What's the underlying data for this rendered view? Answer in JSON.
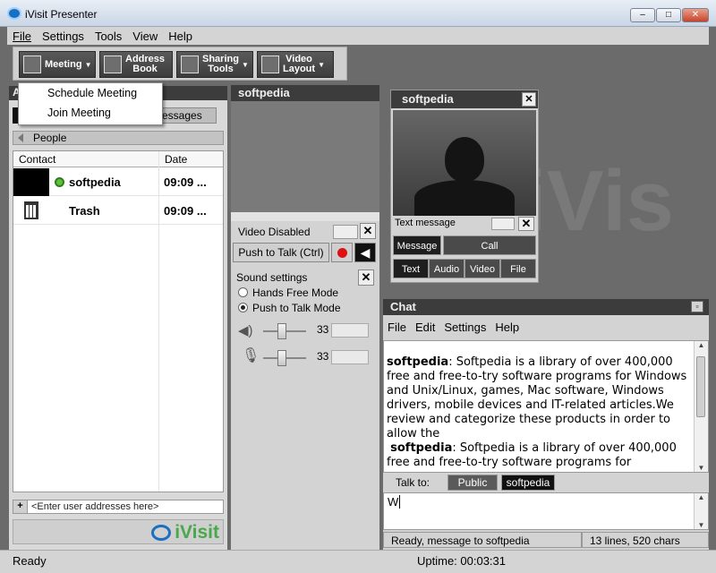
{
  "window": {
    "title": "iVisit Presenter",
    "min": "–",
    "max": "□",
    "close": "✕"
  },
  "menubar": [
    "File",
    "Settings",
    "Tools",
    "View",
    "Help"
  ],
  "toolbar": {
    "meeting": "Meeting",
    "address_book": [
      "Address",
      "Book"
    ],
    "sharing_tools": [
      "Sharing",
      "Tools"
    ],
    "video_layout": [
      "Video",
      "Layout"
    ]
  },
  "meeting_menu": [
    "Schedule Meeting",
    "Join Meeting"
  ],
  "left_panel": {
    "header_letter": "A",
    "tab_messages": "essages",
    "people": "People",
    "columns": [
      "Contact",
      "Date"
    ],
    "contacts": [
      {
        "name": "softpedia",
        "date": "09:09 ...",
        "status": "online"
      },
      {
        "name": "Trash",
        "date": "09:09 ..."
      }
    ],
    "address_placeholder": "<Enter user addresses here>",
    "logo_text": "iVisit"
  },
  "mid_panel": {
    "title": "softpedia",
    "video_disabled": "Video Disabled",
    "push_to_talk": "Push to Talk (Ctrl)",
    "sound_settings": "Sound settings",
    "modes": [
      "Hands Free Mode",
      "Push to Talk Mode"
    ],
    "selected_mode": "Push to Talk Mode",
    "speaker_volume": "33",
    "mic_volume": "33",
    "speaker_level": 0.33,
    "mic_level": 0.33
  },
  "video_window": {
    "title": "softpedia",
    "text_message": "Text message",
    "buttons": [
      "Message",
      "Call"
    ],
    "tabs": [
      "Text",
      "Audio",
      "Video",
      "File"
    ]
  },
  "watermark": "iVis",
  "chat": {
    "title": "Chat",
    "menu": [
      "File",
      "Edit",
      "Settings",
      "Help"
    ],
    "messages": [
      {
        "sender": "softpedia",
        "text": ": Softpedia is a library of over 400,000 free and free-to-try software programs for Windows and Unix/Linux, games, Mac software, Windows drivers, mobile devices and IT-related articles.We review and categorize these products in order to allow the"
      },
      {
        "sender": "softpedia",
        "text": ": Softpedia is a library of over 400,000 free and free-to-try software programs for"
      }
    ],
    "talk_to_label": "Talk to:",
    "talk_to_options": [
      "Public",
      "softpedia"
    ],
    "input_value": "W",
    "status_left": "Ready, message to softpedia",
    "status_right": "13 lines, 520 chars"
  },
  "statusbar": {
    "left": "Ready",
    "uptime": "Uptime: 00:03:31"
  }
}
